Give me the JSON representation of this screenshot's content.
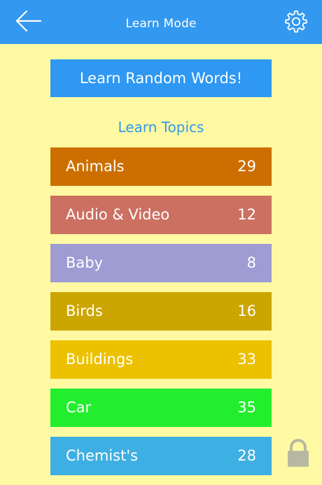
{
  "header": {
    "title": "Learn Mode",
    "back_icon": "back-arrow-icon",
    "settings_icon": "gear-icon",
    "background": "#3399F0"
  },
  "random_button": {
    "label": "Learn Random Words!",
    "color": "#2E98F2"
  },
  "topics_heading": "Learn Topics",
  "topics": [
    {
      "name": "Animals",
      "count": "29",
      "color": "#CC6F00",
      "locked": false
    },
    {
      "name": "Audio & Video",
      "count": "12",
      "color": "#CC7061",
      "locked": false
    },
    {
      "name": "Baby",
      "count": "8",
      "color": "#9E9CD3",
      "locked": false
    },
    {
      "name": "Birds",
      "count": "16",
      "color": "#CCA600",
      "locked": false
    },
    {
      "name": "Buildings",
      "count": "33",
      "color": "#ECC100",
      "locked": false
    },
    {
      "name": "Car",
      "count": "35",
      "color": "#22EE2E",
      "locked": false
    },
    {
      "name": "Chemist's",
      "count": "28",
      "color": "#3EAFE2",
      "locked": true
    }
  ],
  "lock_icon": "lock-icon",
  "background_color": "#FFF9A3"
}
